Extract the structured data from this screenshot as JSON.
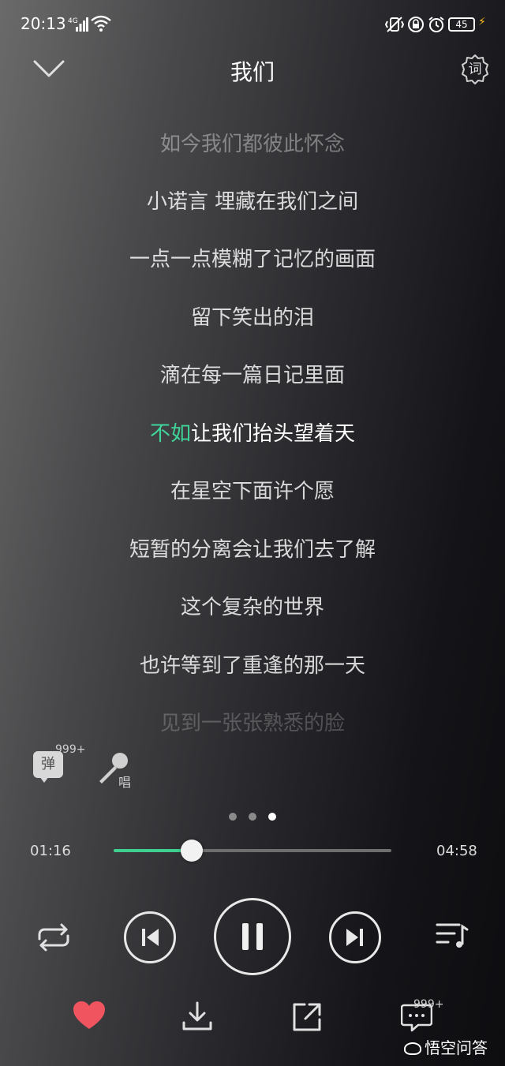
{
  "status_bar": {
    "time": "20:13",
    "network": "4G",
    "battery": "45"
  },
  "header": {
    "title": "我们",
    "lyric_button_label": "词"
  },
  "lyrics": [
    {
      "text": "如今我们都彼此怀念",
      "state": "dim"
    },
    {
      "text": "小诺言 埋藏在我们之间",
      "state": "normal"
    },
    {
      "text": "一点一点模糊了记忆的画面",
      "state": "normal"
    },
    {
      "text": "留下笑出的泪",
      "state": "normal"
    },
    {
      "text": "滴在每一篇日记里面",
      "state": "normal"
    },
    {
      "sung": "不如",
      "rest": "让我们抬头望着天",
      "state": "current"
    },
    {
      "text": "在星空下面许个愿",
      "state": "normal"
    },
    {
      "text": "短暂的分离会让我们去了解",
      "state": "normal"
    },
    {
      "text": "这个复杂的世界",
      "state": "normal"
    },
    {
      "text": "也许等到了重逢的那一天",
      "state": "normal"
    },
    {
      "text": "见到一张张熟悉的脸",
      "state": "dimmer"
    }
  ],
  "danmu": {
    "label": "弹",
    "count": "999+"
  },
  "sing": {
    "label": "唱"
  },
  "pager": {
    "count": 3,
    "active": 2
  },
  "progress": {
    "current": "01:16",
    "total": "04:58",
    "fraction": 0.28
  },
  "controls": {
    "repeat_icon": "repeat-icon",
    "prev_icon": "skip-previous-icon",
    "pause_icon": "pause-icon",
    "next_icon": "skip-next-icon",
    "playlist_icon": "playlist-icon"
  },
  "bottom_bar": {
    "comment_count": "999+",
    "watermark": "悟空问答"
  },
  "colors": {
    "accent": "#3fcf8e",
    "like": "#f0545f"
  }
}
